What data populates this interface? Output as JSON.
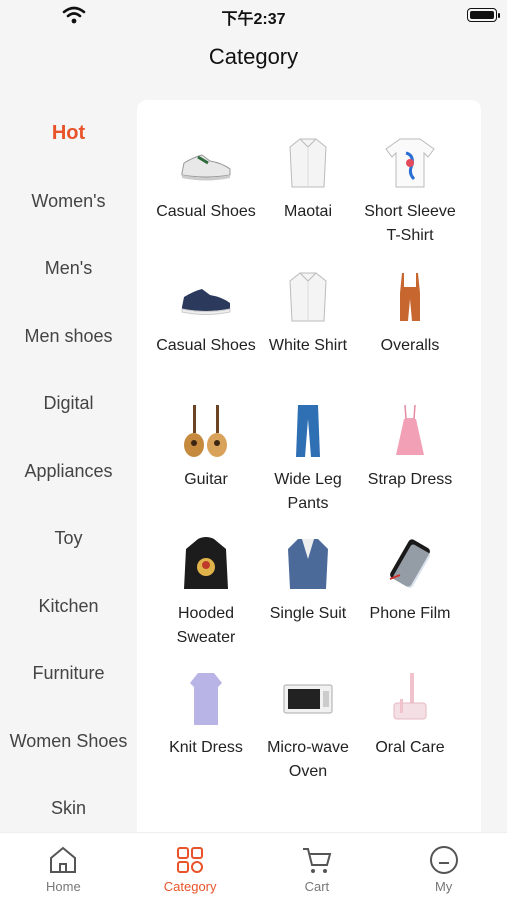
{
  "status_bar": {
    "time": "下午2:37"
  },
  "header": {
    "title": "Category"
  },
  "sidebar": {
    "items": [
      {
        "label": "Hot",
        "active": true
      },
      {
        "label": "Women's"
      },
      {
        "label": "Men's"
      },
      {
        "label": "Men shoes"
      },
      {
        "label": "Digital"
      },
      {
        "label": "Appliances"
      },
      {
        "label": "Toy"
      },
      {
        "label": "Kitchen"
      },
      {
        "label": "Furniture"
      },
      {
        "label": "Women Shoes"
      },
      {
        "label": "Skin"
      }
    ]
  },
  "products": [
    {
      "label": "Casual Shoes",
      "icon": "sneaker-white-icon"
    },
    {
      "label": "Maotai",
      "icon": "white-shirt-icon"
    },
    {
      "label": "Short Sleeve T-Shirt",
      "icon": "tshirt-icon"
    },
    {
      "label": "Casual Shoes",
      "icon": "sneaker-blue-icon"
    },
    {
      "label": "White Shirt",
      "icon": "white-shirt-icon"
    },
    {
      "label": "Overalls",
      "icon": "overalls-icon"
    },
    {
      "label": "Guitar",
      "icon": "guitar-icon"
    },
    {
      "label": "Wide Leg Pants",
      "icon": "pants-icon"
    },
    {
      "label": "Strap Dress",
      "icon": "dress-pink-icon"
    },
    {
      "label": "Hooded Sweater",
      "icon": "hoodie-icon"
    },
    {
      "label": "Single Suit",
      "icon": "suit-icon"
    },
    {
      "label": "Phone Film",
      "icon": "phone-film-icon"
    },
    {
      "label": "Knit Dress",
      "icon": "knit-dress-icon"
    },
    {
      "label": "Micro-wave Oven",
      "icon": "microwave-icon"
    },
    {
      "label": "Oral Care",
      "icon": "toothbrush-icon"
    }
  ],
  "tabbar": {
    "items": [
      {
        "label": "Home",
        "icon": "home-icon"
      },
      {
        "label": "Category",
        "icon": "category-icon",
        "active": true
      },
      {
        "label": "Cart",
        "icon": "cart-icon"
      },
      {
        "label": "My",
        "icon": "profile-icon"
      }
    ]
  },
  "colors": {
    "accent": "#e8532a",
    "background": "#f5f5f5",
    "panel": "#ffffff"
  }
}
